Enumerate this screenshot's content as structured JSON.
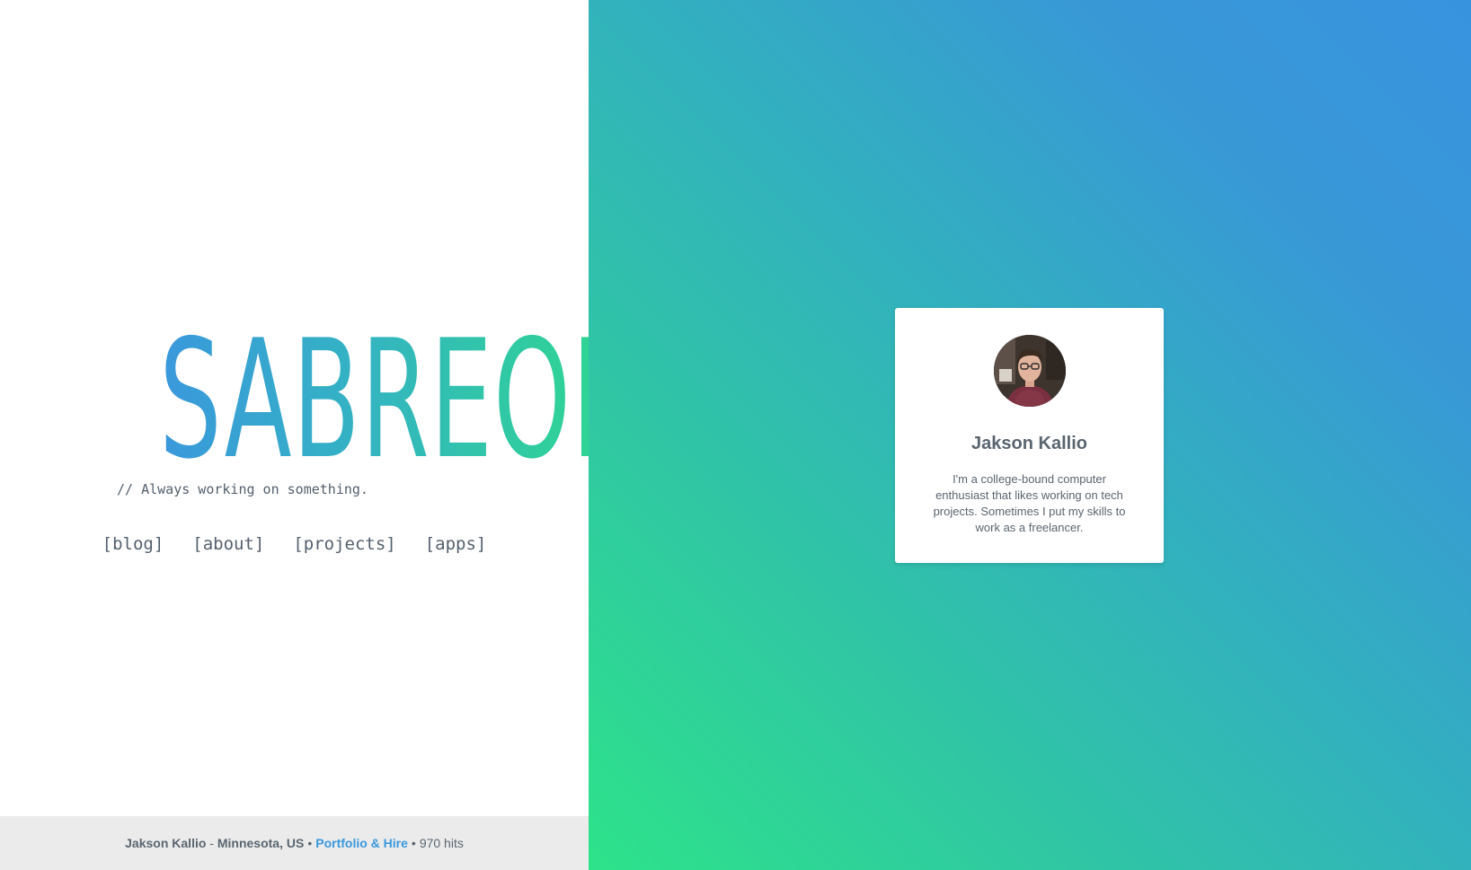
{
  "brand": {
    "logo_text": "SABREOK",
    "tagline": "// Always working on something.",
    "gradient": [
      "#3a98dc",
      "#34b2c4",
      "#2edb8b"
    ]
  },
  "nav": {
    "items": [
      {
        "label": "[blog]"
      },
      {
        "label": "[about]"
      },
      {
        "label": "[projects]"
      },
      {
        "label": "[apps]"
      }
    ]
  },
  "footer": {
    "author": "Jakson Kallio",
    "dash": " - ",
    "location": "Minnesota, US",
    "bullet": "•",
    "link_label": "Portfolio & Hire",
    "hits": "970 hits"
  },
  "profile_card": {
    "name": "Jakson Kallio",
    "bio": "I'm a college-bound computer enthusiast that likes working on tech projects. Sometimes I put my skills to work as a freelancer.",
    "avatar_icon": "profile-photo"
  },
  "colors": {
    "accent": "#3a98dc",
    "text": "#5a6570",
    "background_gradient": [
      "#3893df",
      "#32b1be",
      "#2de38a"
    ],
    "footer_bg": "#ebebeb"
  }
}
